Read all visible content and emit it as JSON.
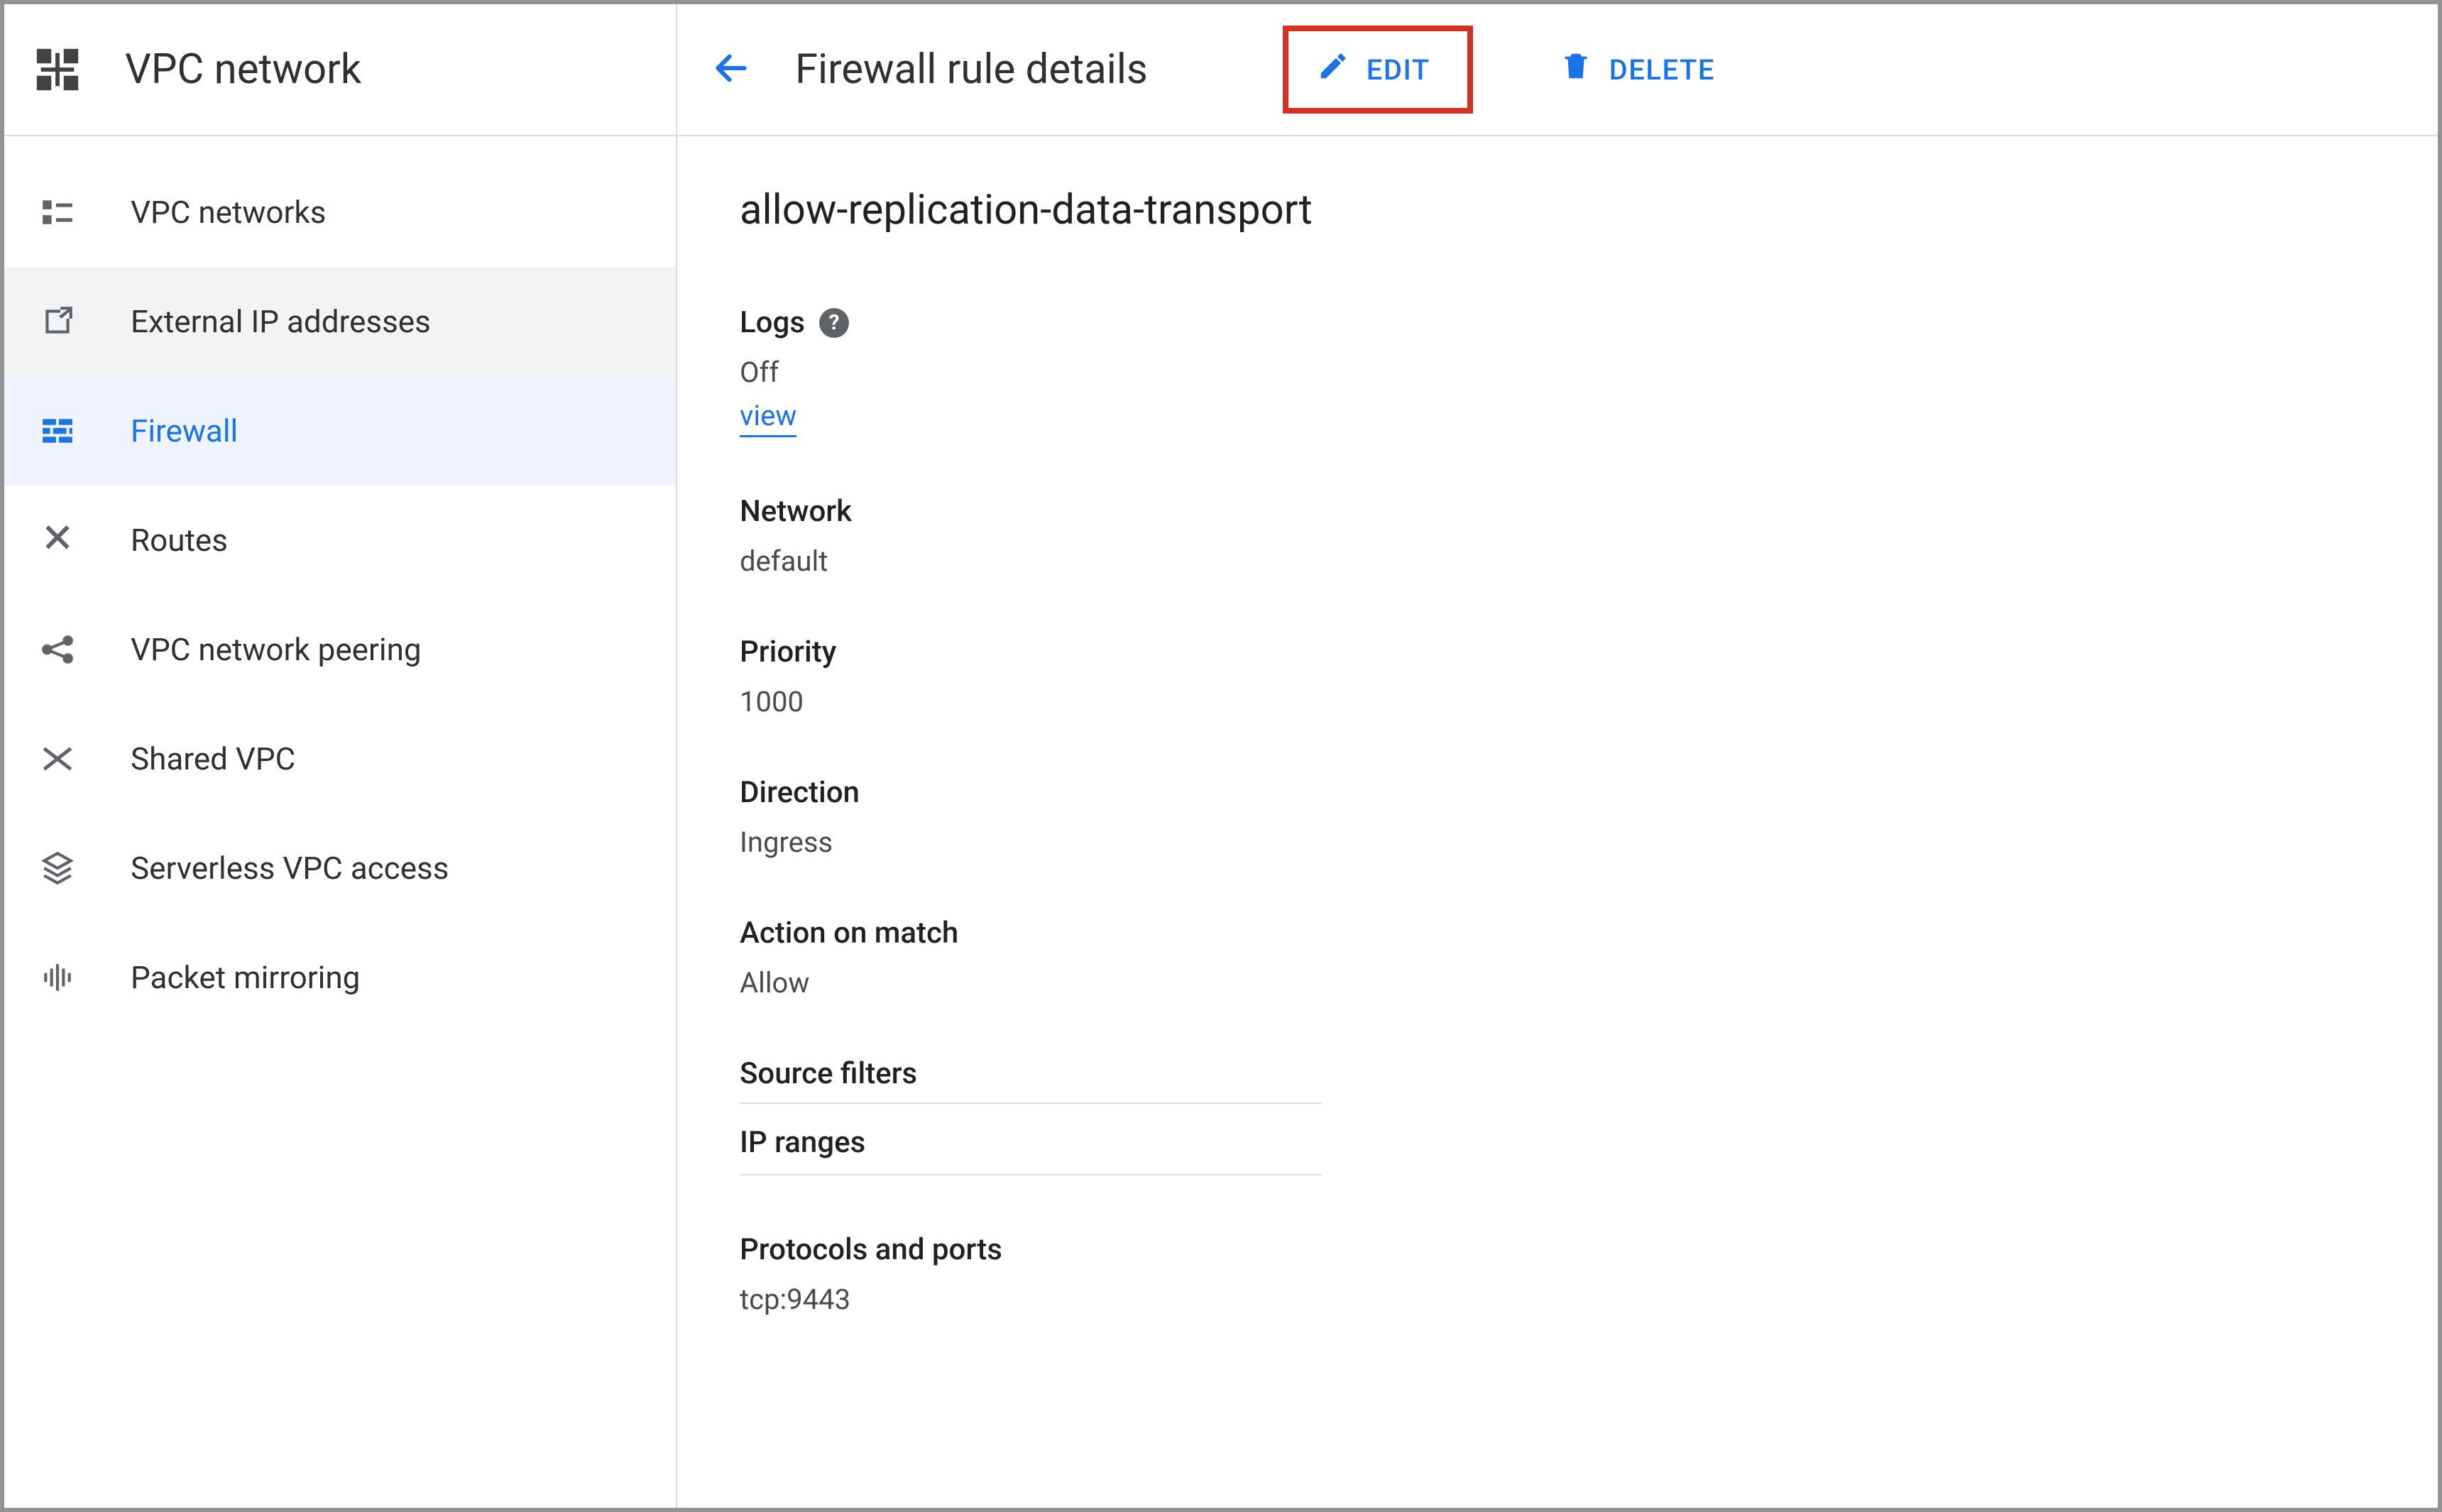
{
  "sidebar": {
    "title": "VPC network",
    "items": [
      {
        "label": "VPC networks"
      },
      {
        "label": "External IP addresses"
      },
      {
        "label": "Firewall"
      },
      {
        "label": "Routes"
      },
      {
        "label": "VPC network peering"
      },
      {
        "label": "Shared VPC"
      },
      {
        "label": "Serverless VPC access"
      },
      {
        "label": "Packet mirroring"
      }
    ],
    "active_index": 2,
    "hover_index": 1
  },
  "header": {
    "title": "Firewall rule details",
    "edit_label": "EDIT",
    "delete_label": "DELETE"
  },
  "rule": {
    "name": "allow-replication-data-transport",
    "logs_label": "Logs",
    "logs_value": "Off",
    "logs_view": "view",
    "network_label": "Network",
    "network_value": "default",
    "priority_label": "Priority",
    "priority_value": "1000",
    "direction_label": "Direction",
    "direction_value": "Ingress",
    "action_label": "Action on match",
    "action_value": "Allow",
    "source_filters_label": "Source filters",
    "ip_ranges_label": "IP ranges",
    "protocols_label": "Protocols and ports",
    "protocols_value": "tcp:9443"
  }
}
